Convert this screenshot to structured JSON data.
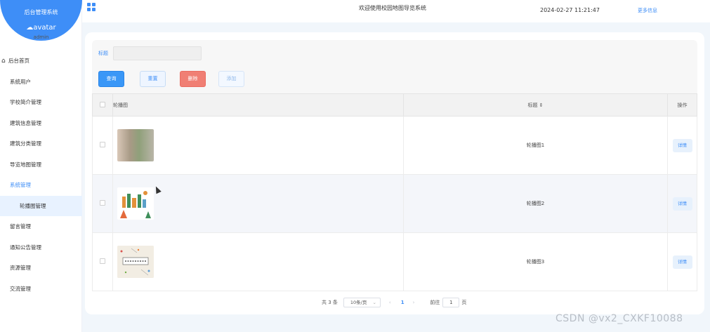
{
  "sidebar": {
    "system_name": "后台管理系统",
    "avatar_alt": "avatar",
    "username": "admin",
    "items": [
      {
        "label": "后台首页"
      },
      {
        "label": "系统用户"
      },
      {
        "label": "学校简介管理"
      },
      {
        "label": "建筑信息管理"
      },
      {
        "label": "建筑分类管理"
      },
      {
        "label": "导览地图管理"
      },
      {
        "label": "系统管理"
      },
      {
        "label": "轮播图管理"
      },
      {
        "label": "留言管理"
      },
      {
        "label": "通知公告管理"
      },
      {
        "label": "资源管理"
      },
      {
        "label": "交流管理"
      }
    ]
  },
  "header": {
    "title": "欢迎使用校园地图导览系统",
    "datetime": "2024-02-27 11:21:47",
    "more": "更多信息"
  },
  "search": {
    "label": "标题",
    "value": "",
    "placeholder": ""
  },
  "buttons": {
    "query": "查询",
    "reset": "重置",
    "delete": "删除",
    "add": "添加"
  },
  "table": {
    "columns": [
      "轮播图",
      "标题 ⇕",
      "操作"
    ],
    "rows": [
      {
        "title": "轮播图1",
        "action": "详情"
      },
      {
        "title": "轮播图2",
        "action": "详情"
      },
      {
        "title": "轮播图3",
        "action": "详情"
      }
    ]
  },
  "pagination": {
    "total": "共 3 条",
    "page_size": "10条/页",
    "current": "1",
    "goto_label": "前往",
    "goto_value": "1",
    "page_unit": "页"
  },
  "watermark": "CSDN @vx2_CXKF10088",
  "colors": {
    "accent": "#3e8ef7",
    "danger": "#f07f74"
  }
}
